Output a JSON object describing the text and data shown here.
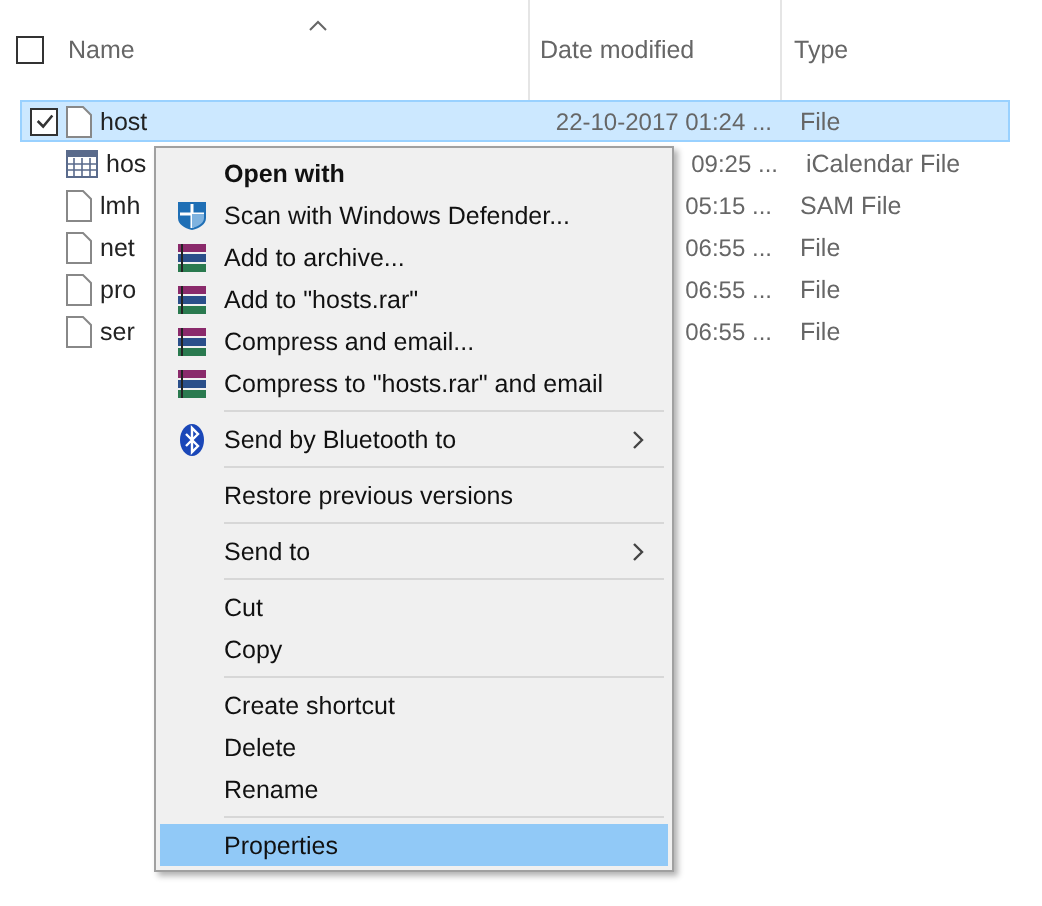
{
  "table": {
    "columns": [
      {
        "label": "Name",
        "sorted": true
      },
      {
        "label": "Date modified",
        "sorted": false
      },
      {
        "label": "Type",
        "sorted": false
      }
    ],
    "select_all": {
      "checked": false
    },
    "rows": [
      {
        "name": "host",
        "date": "22-10-2017 01:24 ...",
        "type": "File",
        "kind": "file",
        "selected": true,
        "checked": true
      },
      {
        "name": "hos",
        "date": "09:25 ...",
        "type": "iCalendar File",
        "kind": "calendar",
        "selected": false,
        "checked": false
      },
      {
        "name": "lmh",
        "date": "05:15 ...",
        "type": "SAM File",
        "kind": "file",
        "selected": false,
        "checked": false
      },
      {
        "name": "net",
        "date": "06:55 ...",
        "type": "File",
        "kind": "file",
        "selected": false,
        "checked": false
      },
      {
        "name": "pro",
        "date": "06:55 ...",
        "type": "File",
        "kind": "file",
        "selected": false,
        "checked": false
      },
      {
        "name": "ser",
        "date": "06:55 ...",
        "type": "File",
        "kind": "file",
        "selected": false,
        "checked": false
      }
    ]
  },
  "context_menu": {
    "items": [
      {
        "kind": "item",
        "label": "Open with",
        "bold": true,
        "selected": false
      },
      {
        "kind": "shield",
        "label": "Scan with Windows Defender...",
        "selected": false
      },
      {
        "kind": "archive",
        "label": "Add to archive...",
        "selected": false
      },
      {
        "kind": "archive",
        "label": "Add to \"hosts.rar\"",
        "selected": false
      },
      {
        "kind": "archive",
        "label": "Compress and email...",
        "selected": false
      },
      {
        "kind": "archive",
        "label": "Compress to \"hosts.rar\" and email",
        "selected": false
      },
      {
        "kind": "separator"
      },
      {
        "kind": "bluetooth",
        "label": "Send by Bluetooth to",
        "submenu": true,
        "selected": false
      },
      {
        "kind": "separator"
      },
      {
        "kind": "item",
        "label": "Restore previous versions",
        "selected": false
      },
      {
        "kind": "separator"
      },
      {
        "kind": "item",
        "label": "Send to",
        "submenu": true,
        "selected": false
      },
      {
        "kind": "separator"
      },
      {
        "kind": "item",
        "label": "Cut",
        "selected": false
      },
      {
        "kind": "item",
        "label": "Copy",
        "selected": false
      },
      {
        "kind": "separator"
      },
      {
        "kind": "item",
        "label": "Create shortcut",
        "selected": false
      },
      {
        "kind": "item",
        "label": "Delete",
        "selected": false
      },
      {
        "kind": "item",
        "label": "Rename",
        "selected": false
      },
      {
        "kind": "separator"
      },
      {
        "kind": "item",
        "label": "Properties",
        "selected": true
      }
    ]
  }
}
